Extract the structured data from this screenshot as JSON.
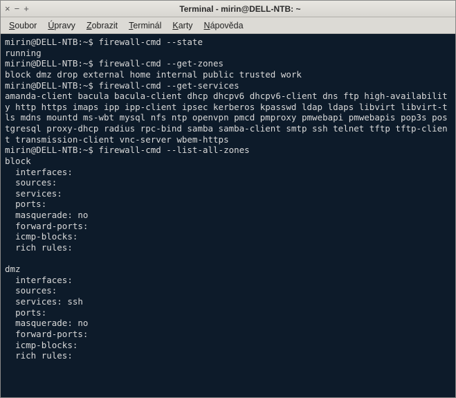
{
  "titlebar": {
    "close": "×",
    "minimize": "−",
    "maximize": "+",
    "title": "Terminal - mirin@DELL-NTB: ~"
  },
  "menubar": {
    "items": [
      {
        "pre": "",
        "ul": "S",
        "post": "oubor"
      },
      {
        "pre": "",
        "ul": "Ú",
        "post": "pravy"
      },
      {
        "pre": "",
        "ul": "Z",
        "post": "obrazit"
      },
      {
        "pre": "",
        "ul": "T",
        "post": "erminál"
      },
      {
        "pre": "",
        "ul": "K",
        "post": "arty"
      },
      {
        "pre": "",
        "ul": "N",
        "post": "ápověda"
      }
    ]
  },
  "prompt": "mirin@DELL-NTB:~$ ",
  "session": {
    "cmd1": "firewall-cmd --state",
    "out1": "running",
    "cmd2": "firewall-cmd --get-zones",
    "out2": "block dmz drop external home internal public trusted work",
    "cmd3": "firewall-cmd --get-services",
    "out3": "amanda-client bacula bacula-client dhcp dhcpv6 dhcpv6-client dns ftp high-availability http https imaps ipp ipp-client ipsec kerberos kpasswd ldap ldaps libvirt libvirt-tls mdns mountd ms-wbt mysql nfs ntp openvpn pmcd pmproxy pmwebapi pmwebapis pop3s postgresql proxy-dhcp radius rpc-bind samba samba-client smtp ssh telnet tftp tftp-client transmission-client vnc-server wbem-https",
    "cmd4": "firewall-cmd --list-all-zones",
    "zone_block": {
      "name": "block",
      "interfaces": "  interfaces:",
      "sources": "  sources:",
      "services": "  services:",
      "ports": "  ports:",
      "masquerade": "  masquerade: no",
      "forward": "  forward-ports:",
      "icmp": "  icmp-blocks:",
      "rich": "  rich rules:"
    },
    "zone_dmz": {
      "name": "dmz",
      "interfaces": "  interfaces:",
      "sources": "  sources:",
      "services": "  services: ssh",
      "ports": "  ports:",
      "masquerade": "  masquerade: no",
      "forward": "  forward-ports:",
      "icmp": "  icmp-blocks:",
      "rich": "  rich rules:"
    }
  }
}
